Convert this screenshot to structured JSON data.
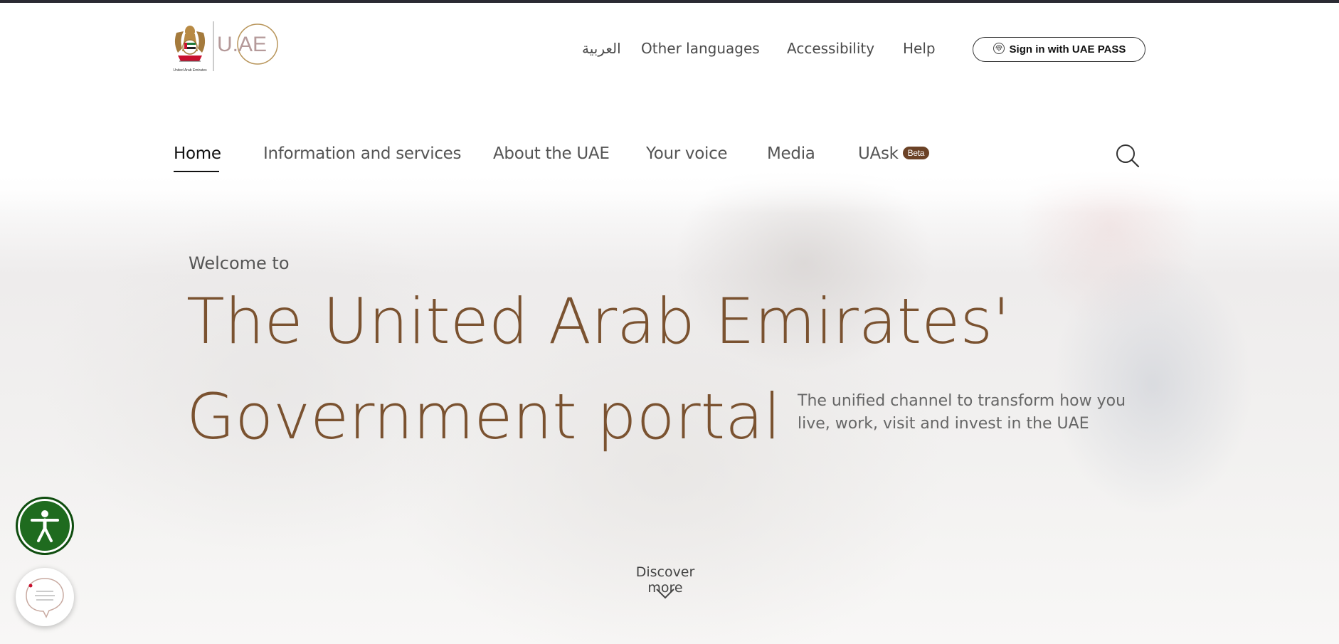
{
  "header": {
    "logo_caption": "United Arab Emirates",
    "logo_wordmark": "U.AE",
    "utility_links": [
      "العربية",
      "Other languages",
      "Accessibility",
      "Help"
    ],
    "signin_label": "Sign in with UAE PASS"
  },
  "nav": {
    "items": [
      {
        "label": "Home",
        "active": true
      },
      {
        "label": "Information and services",
        "active": false
      },
      {
        "label": "About the UAE",
        "active": false
      },
      {
        "label": "Your voice",
        "active": false
      },
      {
        "label": "Media",
        "active": false
      },
      {
        "label": "UAsk",
        "active": false
      }
    ],
    "badge": "Beta"
  },
  "hero": {
    "welcome": "Welcome to",
    "title_line1": "The United Arab Emirates'",
    "title_line2": "Government portal",
    "subtitle": "The unified channel to transform how you live, work, visit and invest in the UAE",
    "discover": "Discover more"
  },
  "icons": {
    "search": "search-icon",
    "discover": "chevron-down-icon",
    "accessibility": "accessibility-icon",
    "chat": "chat-icon",
    "signin": "fingerprint-icon"
  },
  "colors": {
    "brand_brown": "#7a5230",
    "beta_badge": "#6b4226",
    "accessibility_green": "#1f6b1f",
    "logo_gold": "#b8955a"
  }
}
